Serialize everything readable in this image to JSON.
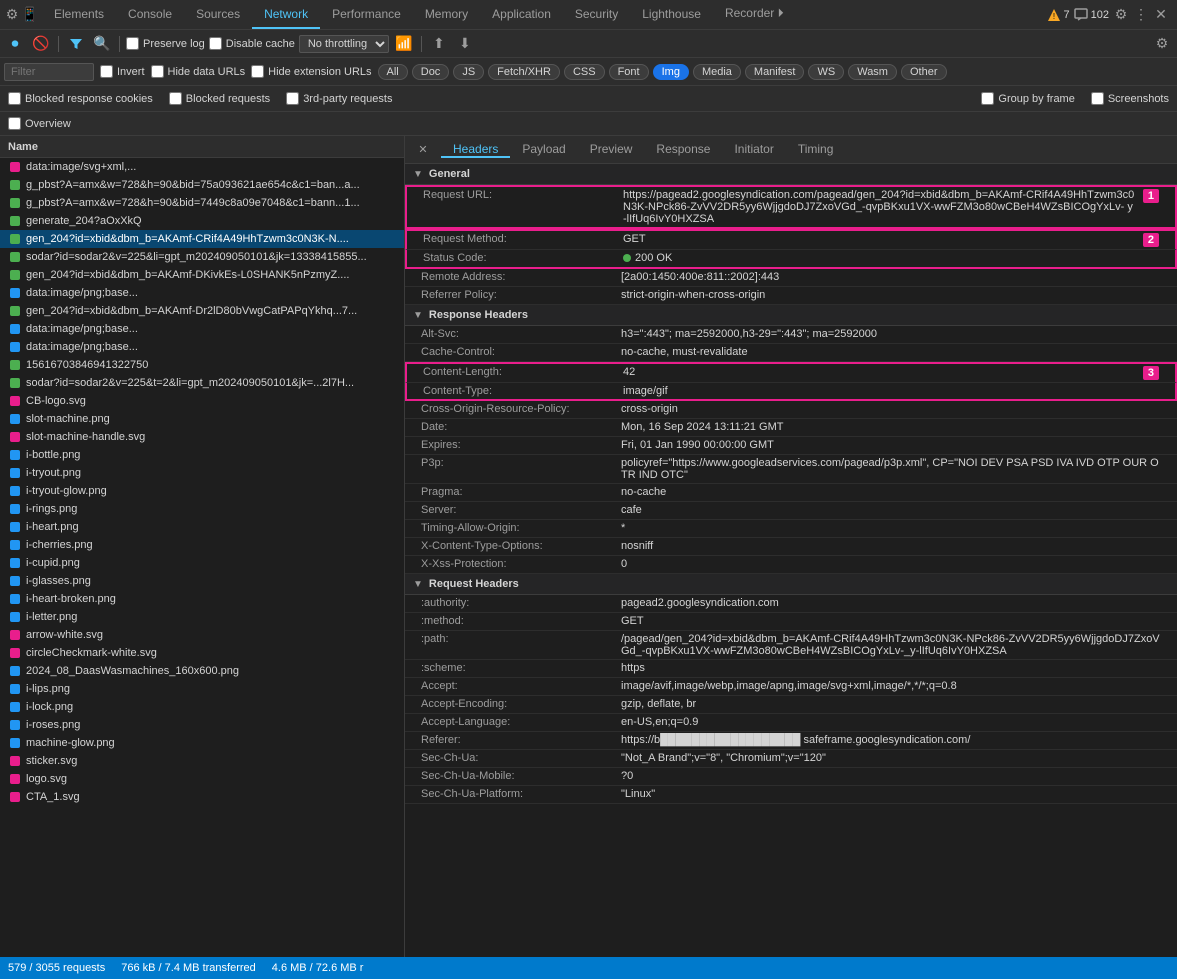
{
  "tabs": [
    {
      "label": "Elements",
      "active": false
    },
    {
      "label": "Console",
      "active": false
    },
    {
      "label": "Sources",
      "active": false
    },
    {
      "label": "Network",
      "active": true
    },
    {
      "label": "Performance",
      "active": false
    },
    {
      "label": "Memory",
      "active": false
    },
    {
      "label": "Application",
      "active": false
    },
    {
      "label": "Security",
      "active": false
    },
    {
      "label": "Lighthouse",
      "active": false
    },
    {
      "label": "Recorder ⏵",
      "active": false
    }
  ],
  "toolbar": {
    "preserve_log": "Preserve log",
    "disable_cache": "Disable cache",
    "throttle": "No throttling"
  },
  "filter_pills": [
    {
      "label": "All",
      "active": false
    },
    {
      "label": "Doc",
      "active": false
    },
    {
      "label": "JS",
      "active": false
    },
    {
      "label": "Fetch/XHR",
      "active": false
    },
    {
      "label": "CSS",
      "active": false
    },
    {
      "label": "Font",
      "active": false
    },
    {
      "label": "Img",
      "active": true
    },
    {
      "label": "Media",
      "active": false
    },
    {
      "label": "Manifest",
      "active": false
    },
    {
      "label": "WS",
      "active": false
    },
    {
      "label": "Wasm",
      "active": false
    },
    {
      "label": "Other",
      "active": false
    }
  ],
  "checkboxes": {
    "blocked_cookies": "Blocked response cookies",
    "blocked_requests": "Blocked requests",
    "third_party": "3rd-party requests",
    "group_by_frame": "Group by frame",
    "screenshots": "Screenshots"
  },
  "overview": "Overview",
  "col_name": "Name",
  "files": [
    {
      "name": "data:image/svg+xml,...",
      "icon": "svg",
      "selected": false
    },
    {
      "name": "g_pbst?A=amx&w=728&h=90&bid=75a093621ae654c&c1=ban...a...",
      "icon": "img",
      "selected": false
    },
    {
      "name": "g_pbst?A=amx&w=728&h=90&bid=7449c8a09e7048&c1=bann...1...",
      "icon": "img",
      "selected": false
    },
    {
      "name": "generate_204?aOxXkQ",
      "icon": "img",
      "selected": false
    },
    {
      "name": "gen_204?id=xbid&dbm_b=AKAmf-CRif4A49HhTzwm3c0N3K-N....",
      "icon": "img",
      "selected": true
    },
    {
      "name": "sodar?id=sodar2&v=225&li=gpt_m202409050101&jk=13338415855...",
      "icon": "img",
      "selected": false
    },
    {
      "name": "gen_204?id=xbid&dbm_b=AKAmf-DKivkEs-L0SHANK5nPzmyZ....",
      "icon": "img",
      "selected": false
    },
    {
      "name": "data:image/png;base...",
      "icon": "png",
      "selected": false
    },
    {
      "name": "gen_204?id=xbid&dbm_b=AKAmf-Dr2lD80bVwgCatPAPqYkhq...7...",
      "icon": "img",
      "selected": false
    },
    {
      "name": "data:image/png;base...",
      "icon": "png",
      "selected": false
    },
    {
      "name": "data:image/png;base...",
      "icon": "png",
      "selected": false
    },
    {
      "name": "15616703846941322750",
      "icon": "img",
      "selected": false
    },
    {
      "name": "sodar?id=sodar2&v=225&t=2&li=gpt_m202409050101&jk=...2l7H...",
      "icon": "img",
      "selected": false
    },
    {
      "name": "CB-logo.svg",
      "icon": "svg",
      "selected": false
    },
    {
      "name": "slot-machine.png",
      "icon": "png",
      "selected": false
    },
    {
      "name": "slot-machine-handle.svg",
      "icon": "svg",
      "selected": false
    },
    {
      "name": "i-bottle.png",
      "icon": "png",
      "selected": false
    },
    {
      "name": "i-tryout.png",
      "icon": "png",
      "selected": false
    },
    {
      "name": "i-tryout-glow.png",
      "icon": "png",
      "selected": false
    },
    {
      "name": "i-rings.png",
      "icon": "png",
      "selected": false
    },
    {
      "name": "i-heart.png",
      "icon": "png",
      "selected": false
    },
    {
      "name": "i-cherries.png",
      "icon": "png",
      "selected": false
    },
    {
      "name": "i-cupid.png",
      "icon": "png",
      "selected": false
    },
    {
      "name": "i-glasses.png",
      "icon": "png",
      "selected": false
    },
    {
      "name": "i-heart-broken.png",
      "icon": "png",
      "selected": false
    },
    {
      "name": "i-letter.png",
      "icon": "png",
      "selected": false
    },
    {
      "name": "arrow-white.svg",
      "icon": "svg",
      "selected": false
    },
    {
      "name": "circleCheckmark-white.svg",
      "icon": "svg",
      "selected": false
    },
    {
      "name": "2024_08_DaasWasmachines_160x600.png",
      "icon": "png",
      "selected": false
    },
    {
      "name": "i-lips.png",
      "icon": "png",
      "selected": false
    },
    {
      "name": "i-lock.png",
      "icon": "png",
      "selected": false
    },
    {
      "name": "i-roses.png",
      "icon": "png",
      "selected": false
    },
    {
      "name": "machine-glow.png",
      "icon": "png",
      "selected": false
    },
    {
      "name": "sticker.svg",
      "icon": "svg",
      "selected": false
    },
    {
      "name": "logo.svg",
      "icon": "svg",
      "selected": false
    },
    {
      "name": "CTA_1.svg",
      "icon": "svg",
      "selected": false
    }
  ],
  "panel_tabs": [
    {
      "label": "Headers",
      "active": true
    },
    {
      "label": "Payload",
      "active": false
    },
    {
      "label": "Preview",
      "active": false
    },
    {
      "label": "Response",
      "active": false
    },
    {
      "label": "Initiator",
      "active": false
    },
    {
      "label": "Timing",
      "active": false
    }
  ],
  "sections": {
    "general": {
      "title": "General",
      "rows": [
        {
          "key": "Request URL:",
          "val": "https://pagead2.googlesyndication.com/pagead/gen_204?id=xbid&dbm_b=AKAmf-CRif4A49HhTzwm3c0N3K-NPck86-ZvVV2DR5yy6WjjgdoDJ7ZxoVGd_-qvpBKxu1VX-wwFZM3o80wCBeH4WZsBICOgYxLv- y-lIfUq6IvY0HXZSA"
        },
        {
          "key": "Request Method:",
          "val": "GET"
        },
        {
          "key": "Status Code:",
          "val": "200 OK",
          "status": true
        },
        {
          "key": "Remote Address:",
          "val": "[2a00:1450:400e:811::2002]:443"
        },
        {
          "key": "Referrer Policy:",
          "val": "strict-origin-when-cross-origin"
        }
      ]
    },
    "response_headers": {
      "title": "Response Headers",
      "rows": [
        {
          "key": "Alt-Svc:",
          "val": "h3=\":443\"; ma=2592000,h3-29=\":443\"; ma=2592000"
        },
        {
          "key": "Cache-Control:",
          "val": "no-cache, must-revalidate"
        },
        {
          "key": "Content-Length:",
          "val": "42"
        },
        {
          "key": "Content-Type:",
          "val": "image/gif"
        },
        {
          "key": "Cross-Origin-Resource-Policy:",
          "val": "cross-origin"
        },
        {
          "key": "Date:",
          "val": "Mon, 16 Sep 2024 13:11:21 GMT"
        },
        {
          "key": "Expires:",
          "val": "Fri, 01 Jan 1990 00:00:00 GMT"
        },
        {
          "key": "P3p:",
          "val": "policyref=\"https://www.googleadservices.com/pagead/p3p.xml\", CP=\"NOI DEV PSA PSD IVA IVD OTP OUR OTR IND OTC\""
        },
        {
          "key": "Pragma:",
          "val": "no-cache"
        },
        {
          "key": "Server:",
          "val": "cafe"
        },
        {
          "key": "Timing-Allow-Origin:",
          "val": "*"
        },
        {
          "key": "X-Content-Type-Options:",
          "val": "nosniff"
        },
        {
          "key": "X-Xss-Protection:",
          "val": "0"
        }
      ]
    },
    "request_headers": {
      "title": "Request Headers",
      "rows": [
        {
          "key": ":authority:",
          "val": "pagead2.googlesyndication.com"
        },
        {
          "key": ":method:",
          "val": "GET"
        },
        {
          "key": ":path:",
          "val": "/pagead/gen_204?id=xbid&dbm_b=AKAmf-CRif4A49HhTzwm3c0N3K-NPck86-ZvVV2DR5yy6WjjgdoDJ7ZxoVGd_-qvpBKxu1VX-wwFZM3o80wCBeH4WZsBICOgYxLv-_y-lIfUq6IvY0HXZSA"
        },
        {
          "key": ":scheme:",
          "val": "https"
        },
        {
          "key": "Accept:",
          "val": "image/avif,image/webp,image/apng,image/svg+xml,image/*,*/*;q=0.8"
        },
        {
          "key": "Accept-Encoding:",
          "val": "gzip, deflate, br"
        },
        {
          "key": "Accept-Language:",
          "val": "en-US,en;q=0.9"
        },
        {
          "key": "Referer:",
          "val": "https://b██████████████████ safeframe.googlesyndication.com/"
        },
        {
          "key": "Sec-Ch-Ua:",
          "val": "\"Not_A Brand\";v=\"8\", \"Chromium\";v=\"120\""
        },
        {
          "key": "Sec-Ch-Ua-Mobile:",
          "val": "?0"
        },
        {
          "key": "Sec-Ch-Ua-Platform:",
          "val": "\"Linux\""
        }
      ]
    }
  },
  "status_bar": {
    "requests": "579 / 3055 requests",
    "transferred": "766 kB / 7.4 MB transferred",
    "resources": "4.6 MB / 72.6 MB r"
  },
  "alerts": {
    "warnings": "7",
    "messages": "102"
  },
  "annotations": [
    {
      "id": "1",
      "label": "1"
    },
    {
      "id": "2",
      "label": "2"
    },
    {
      "id": "3",
      "label": "3"
    }
  ]
}
